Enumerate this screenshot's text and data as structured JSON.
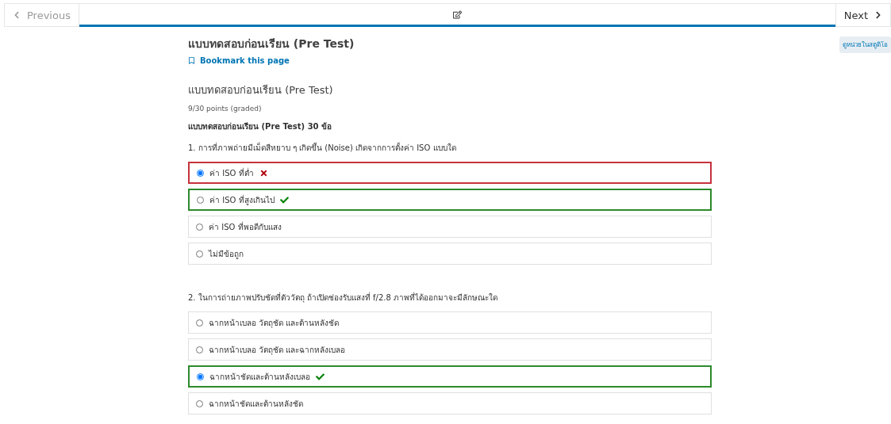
{
  "nav": {
    "previous": "Previous",
    "next": "Next",
    "tabs": [
      {
        "kind": "edit",
        "selected": true
      }
    ]
  },
  "studio_badge": "ดูหน่วยในสตูดิโอ",
  "page_title": "แบบทดสอบก่อนเรียน (Pre Test)",
  "bookmark": "Bookmark this page",
  "problem": {
    "title": "แบบทดสอบก่อนเรียน (Pre Test)",
    "points": "9/30 points (graded)",
    "intro": "แบบทดสอบก่อนเรียน (Pre Test) 30 ข้อ",
    "questions": [
      {
        "text": "1. การที่ภาพถ่ายมีเม็ดสีหยาบ ๆ เกิดขึ้น (Noise) เกิดจากการตั้งค่า ISO แบบใด",
        "options": [
          {
            "label": "ค่า ISO ที่ต่ำ",
            "selected": true,
            "correct": false
          },
          {
            "label": "ค่า ISO ที่สูงเกินไป",
            "selected": false,
            "correct": true
          },
          {
            "label": "ค่า ISO ที่พอดีกับแสง",
            "selected": false,
            "correct": false
          },
          {
            "label": "ไม่มีข้อถูก",
            "selected": false,
            "correct": false
          }
        ]
      },
      {
        "text": "2. ในการถ่ายภาพปรับชัดที่ตัววัตถุ ถ้าเปิดช่องรับแสงที่ f/2.8 ภาพที่ได้ออกมาจะมีลักษณะใด",
        "options": [
          {
            "label": "ฉากหน้าเบลอ วัตถุชัด และต้านหลังชัด",
            "selected": false,
            "correct": false
          },
          {
            "label": "ฉากหน้าเบลอ วัตถุชัด และฉากหลังเบลอ",
            "selected": false,
            "correct": false
          },
          {
            "label": "ฉากหน้าชัดและต้านหลังเบลอ",
            "selected": true,
            "correct": true
          },
          {
            "label": "ฉากหน้าชัดและต้านหลังชัด",
            "selected": false,
            "correct": false
          }
        ]
      }
    ]
  }
}
